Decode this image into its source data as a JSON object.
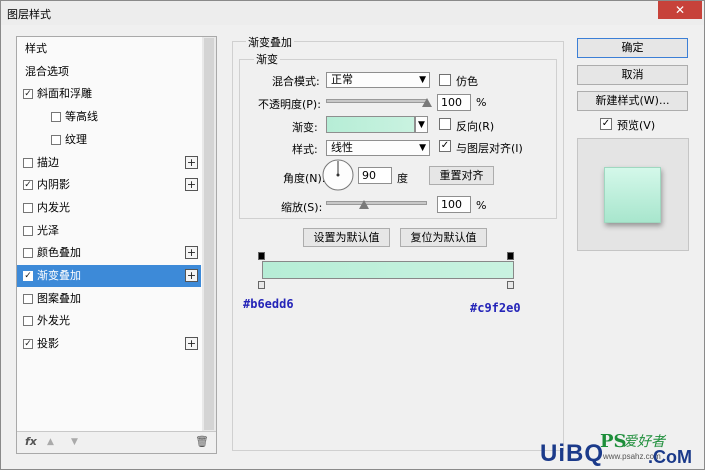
{
  "window": {
    "title": "图层样式",
    "close_glyph": "✕"
  },
  "layers_panel": {
    "items": [
      {
        "label": "样式",
        "checkbox": false,
        "checked": false,
        "plus": false,
        "selected": false,
        "indent": false
      },
      {
        "label": "混合选项",
        "checkbox": false,
        "checked": false,
        "plus": false,
        "selected": false,
        "indent": false
      },
      {
        "label": "斜面和浮雕",
        "checkbox": true,
        "checked": true,
        "plus": false,
        "selected": false,
        "indent": false
      },
      {
        "label": "等高线",
        "checkbox": true,
        "checked": false,
        "plus": false,
        "selected": false,
        "indent": true
      },
      {
        "label": "纹理",
        "checkbox": true,
        "checked": false,
        "plus": false,
        "selected": false,
        "indent": true
      },
      {
        "label": "描边",
        "checkbox": true,
        "checked": false,
        "plus": true,
        "selected": false,
        "indent": false
      },
      {
        "label": "内阴影",
        "checkbox": true,
        "checked": true,
        "plus": true,
        "selected": false,
        "indent": false
      },
      {
        "label": "内发光",
        "checkbox": true,
        "checked": false,
        "plus": false,
        "selected": false,
        "indent": false
      },
      {
        "label": "光泽",
        "checkbox": true,
        "checked": false,
        "plus": false,
        "selected": false,
        "indent": false
      },
      {
        "label": "颜色叠加",
        "checkbox": true,
        "checked": false,
        "plus": true,
        "selected": false,
        "indent": false
      },
      {
        "label": "渐变叠加",
        "checkbox": true,
        "checked": true,
        "plus": true,
        "selected": true,
        "indent": false
      },
      {
        "label": "图案叠加",
        "checkbox": true,
        "checked": false,
        "plus": false,
        "selected": false,
        "indent": false
      },
      {
        "label": "外发光",
        "checkbox": true,
        "checked": false,
        "plus": false,
        "selected": false,
        "indent": false
      },
      {
        "label": "投影",
        "checkbox": true,
        "checked": true,
        "plus": true,
        "selected": false,
        "indent": false
      }
    ],
    "footer": {
      "fx_label": "fx",
      "up_glyph": "▲",
      "down_glyph": "▼",
      "trash_glyph": "🗑"
    }
  },
  "gradient_overlay": {
    "section_title": "渐变叠加",
    "subsection_title": "渐变",
    "blend_mode_label": "混合模式:",
    "blend_mode_value": "正常",
    "dither_label": "仿色",
    "dither_checked": false,
    "opacity_label": "不透明度(P):",
    "opacity_value": "100",
    "opacity_unit": "%",
    "opacity_level": 1.0,
    "gradient_label": "渐变:",
    "reverse_label": "反向(R)",
    "reverse_checked": false,
    "style_label": "样式:",
    "style_value": "线性",
    "align_label": "与图层对齐(I)",
    "align_checked": true,
    "angle_label": "角度(N):",
    "angle_value": "90",
    "angle_unit": "度",
    "reset_align_button": "重置对齐",
    "scale_label": "缩放(S):",
    "scale_value": "100",
    "scale_unit": "%",
    "scale_level": 0.38,
    "make_default_button": "设置为默认值",
    "reset_default_button": "复位为默认值"
  },
  "gradient_editor": {
    "start_color": "#b6edd6",
    "end_color": "#c9f2e0",
    "start_label": "#b6edd6",
    "end_label": "#c9f2e0"
  },
  "right_panel": {
    "ok_button": "确定",
    "cancel_button": "取消",
    "new_style_button": "新建样式(W)...",
    "preview_label": "预览(V)",
    "preview_checked": true
  },
  "watermark": {
    "ps_text": "PS",
    "hand_text": "爱好者",
    "uibq_text": "UiBQ",
    "com_text": ".CoM",
    "small_text": "www.psahz.com"
  }
}
